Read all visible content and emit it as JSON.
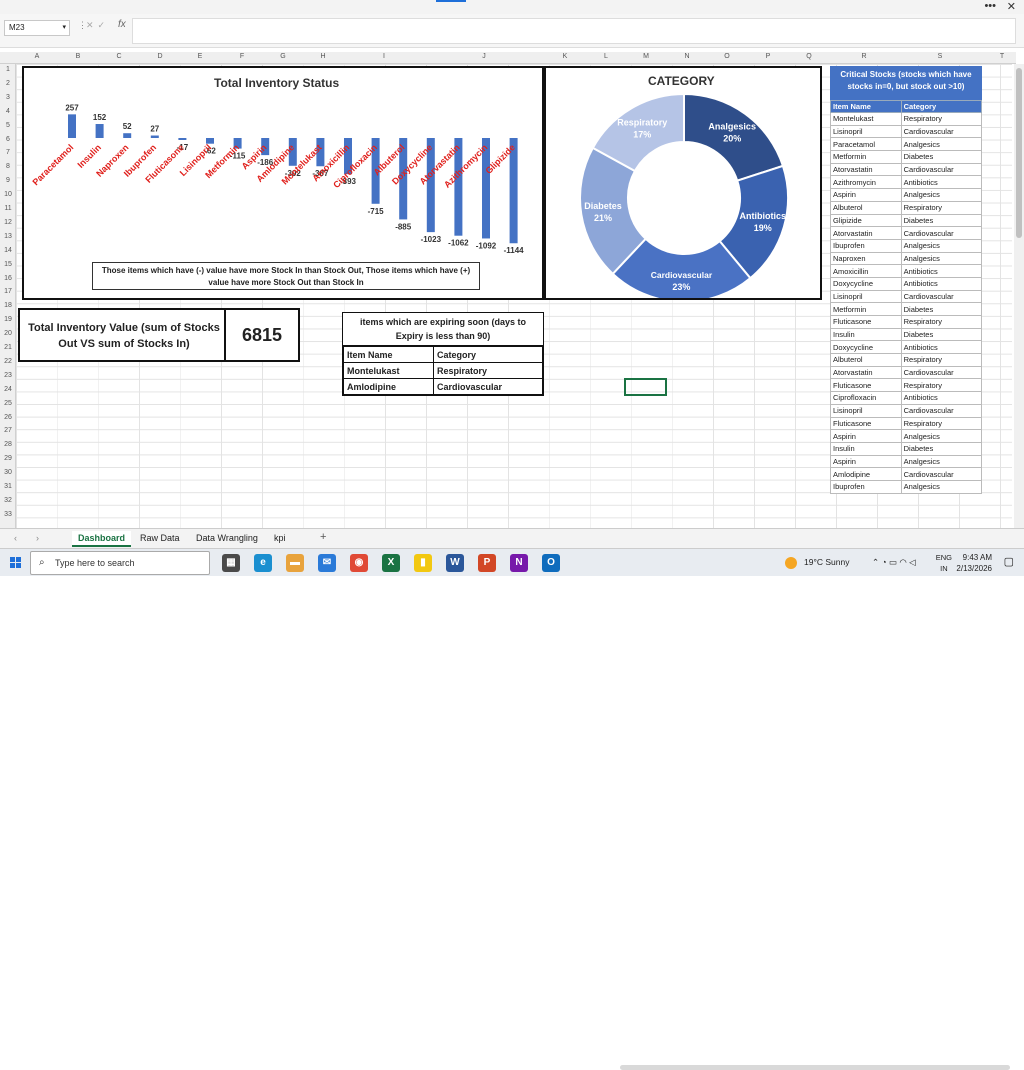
{
  "name_box": "M23",
  "fx_label": "fx",
  "columns": [
    "A",
    "B",
    "C",
    "D",
    "E",
    "F",
    "G",
    "H",
    "I",
    "J",
    "K",
    "L",
    "M",
    "N",
    "O",
    "P",
    "Q",
    "R",
    "S",
    "T"
  ],
  "rows": [
    "1",
    "2",
    "3",
    "4",
    "5",
    "6",
    "7",
    "8",
    "9",
    "10",
    "11",
    "12",
    "13",
    "14",
    "15",
    "16",
    "17",
    "18",
    "19",
    "20",
    "21",
    "22",
    "23",
    "24",
    "25",
    "26",
    "27",
    "28",
    "29",
    "30",
    "31",
    "32",
    "33"
  ],
  "inventory_chart": {
    "title": "Total Inventory Status",
    "note": "Those items which have (-) value have more Stock In than Stock Out, Those items which have (+) value have more Stock Out than Stock In"
  },
  "chart_data": [
    {
      "type": "bar",
      "title": "Total Inventory Status",
      "categories": [
        "Paracetamol",
        "Insulin",
        "Naproxen",
        "Ibuprofen",
        "Fluticasone",
        "Lisinopril",
        "Metformin",
        "Aspirin",
        "Amlodipine",
        "Montelukast",
        "Amoxicillin",
        "Ciprofloxacin",
        "Albuterol",
        "Doxycycline",
        "Atorvastatin",
        "Azithromycin",
        "Glipizide"
      ],
      "values": [
        257,
        152,
        52,
        27,
        -17,
        -62,
        -115,
        -186,
        -302,
        -307,
        -393,
        -715,
        -885,
        -1023,
        -1062,
        -1092,
        -1144
      ],
      "data_labels": [
        "257",
        "152",
        "52",
        "27",
        "-17",
        "-62",
        "-115",
        "-186",
        "-302",
        "-307",
        "-393",
        "-715",
        "-885",
        "-1023",
        "-1062",
        "-1092",
        "-1144"
      ],
      "bar_color": "#4472c4",
      "category_label_color": "#e0201c"
    },
    {
      "type": "pie",
      "title": "CATEGORY",
      "donut": true,
      "labels": [
        "Analgesics",
        "Antibiotics",
        "Cardiovascular",
        "Diabetes",
        "Respiratory"
      ],
      "percent_labels": [
        "20%",
        "19%",
        "23%",
        "21%",
        "17%"
      ],
      "values": [
        20,
        19,
        23,
        21,
        17
      ],
      "colors": [
        "#2f4e8a",
        "#3a62b0",
        "#4a72c4",
        "#8da6d8",
        "#b5c4e6"
      ]
    }
  ],
  "total_value": {
    "label": "Total Inventory Value (sum of Stocks Out VS sum of Stocks In)",
    "value": "6815"
  },
  "expiring": {
    "title": "items which are expiring soon (days to Expiry is less than 90)",
    "headers": [
      "Item Name",
      "Category"
    ],
    "rows": [
      [
        "Montelukast",
        "Respiratory"
      ],
      [
        "Amlodipine",
        "Cardiovascular"
      ]
    ]
  },
  "critical": {
    "title": "Critical Stocks (stocks which have stocks in=0, but stock out >10)",
    "headers": [
      "Item Name",
      "Category"
    ],
    "rows": [
      [
        "Montelukast",
        "Respiratory"
      ],
      [
        "Lisinopril",
        "Cardiovascular"
      ],
      [
        "Paracetamol",
        "Analgesics"
      ],
      [
        "Metformin",
        "Diabetes"
      ],
      [
        "Atorvastatin",
        "Cardiovascular"
      ],
      [
        "Azithromycin",
        "Antibiotics"
      ],
      [
        "Aspirin",
        "Analgesics"
      ],
      [
        "Albuterol",
        "Respiratory"
      ],
      [
        "Glipizide",
        "Diabetes"
      ],
      [
        "Atorvastatin",
        "Cardiovascular"
      ],
      [
        "Ibuprofen",
        "Analgesics"
      ],
      [
        "Naproxen",
        "Analgesics"
      ],
      [
        "Amoxicillin",
        "Antibiotics"
      ],
      [
        "Doxycycline",
        "Antibiotics"
      ],
      [
        "Lisinopril",
        "Cardiovascular"
      ],
      [
        "Metformin",
        "Diabetes"
      ],
      [
        "Fluticasone",
        "Respiratory"
      ],
      [
        "Insulin",
        "Diabetes"
      ],
      [
        "Doxycycline",
        "Antibiotics"
      ],
      [
        "Albuterol",
        "Respiratory"
      ],
      [
        "Atorvastatin",
        "Cardiovascular"
      ],
      [
        "Fluticasone",
        "Respiratory"
      ],
      [
        "Ciprofloxacin",
        "Antibiotics"
      ],
      [
        "Lisinopril",
        "Cardiovascular"
      ],
      [
        "Fluticasone",
        "Respiratory"
      ],
      [
        "Aspirin",
        "Analgesics"
      ],
      [
        "Insulin",
        "Diabetes"
      ],
      [
        "Aspirin",
        "Analgesics"
      ],
      [
        "Amlodipine",
        "Cardiovascular"
      ],
      [
        "Ibuprofen",
        "Analgesics"
      ]
    ]
  },
  "sheet_tabs": [
    "Dashboard",
    "Raw Data",
    "Data Wrangling",
    "kpi"
  ],
  "active_tab": "Dashboard",
  "taskbar": {
    "search_placeholder": "Type here to search",
    "weather": "19°C  Sunny",
    "lang_top": "ENG",
    "lang_bottom": "IN",
    "time": "9:43 AM",
    "date": "2/13/2026"
  }
}
